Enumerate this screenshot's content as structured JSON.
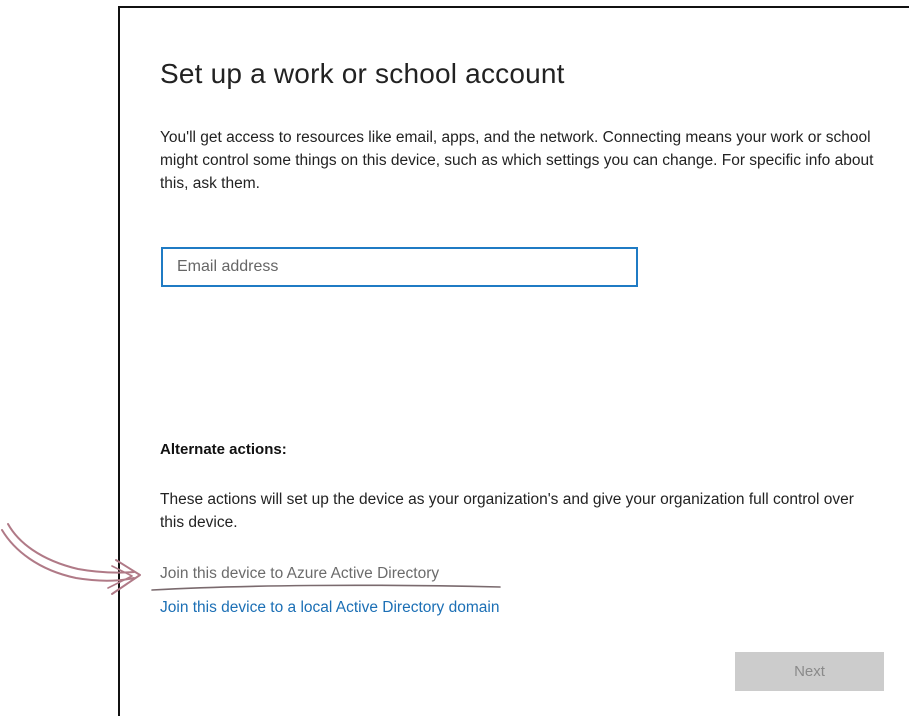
{
  "dialog": {
    "title": "Set up a work or school account",
    "description": "You'll get access to resources like email, apps, and the network. Connecting means your work or school might control some things on this device, such as which settings you can change. For specific info about this, ask them.",
    "email_input": {
      "value": "",
      "placeholder": "Email address"
    },
    "alternate_actions": {
      "heading": "Alternate actions:",
      "description": "These actions will set up the device as your organization's and give your organization full control over this device.",
      "links": [
        {
          "label": "Join this device to Azure Active Directory"
        },
        {
          "label": "Join this device to a local Active Directory domain"
        }
      ]
    },
    "next_button": {
      "label": "Next",
      "enabled": false
    }
  },
  "annotation": {
    "icon": "hand-drawn-arrow-icon",
    "color": "#b07a87"
  },
  "colors": {
    "accent": "#1f7bc4",
    "link": "#1b6fb5",
    "disabled_button": "#cccccc"
  }
}
